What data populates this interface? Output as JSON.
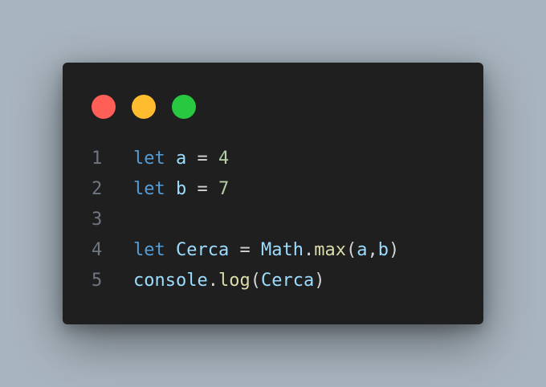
{
  "window": {
    "traffic_lights": [
      {
        "name": "close",
        "color": "#ff5f57"
      },
      {
        "name": "minimize",
        "color": "#febc2e"
      },
      {
        "name": "maximize",
        "color": "#28c840"
      }
    ]
  },
  "editor": {
    "lines": [
      {
        "number": "1",
        "tokens": [
          "let",
          " ",
          "a",
          " = ",
          "4"
        ]
      },
      {
        "number": "2",
        "tokens": [
          "let",
          " ",
          "b",
          " = ",
          "7"
        ]
      },
      {
        "number": "3",
        "tokens": []
      },
      {
        "number": "4",
        "tokens": [
          "let",
          " ",
          "Cerca",
          " = ",
          "Math",
          ".",
          "max",
          "(",
          "a",
          ",",
          "b",
          ")"
        ]
      },
      {
        "number": "5",
        "tokens": [
          "console",
          ".",
          "log",
          "(",
          "Cerca",
          ")"
        ]
      }
    ]
  },
  "colors": {
    "background": "#a8b4be",
    "window": "#1f1f1f",
    "keyword": "#569cd6",
    "variable": "#9cdcfe",
    "number": "#b5cea8",
    "function": "#dcdcaa",
    "operator": "#d4d4d4",
    "line_number": "#6e7681"
  }
}
